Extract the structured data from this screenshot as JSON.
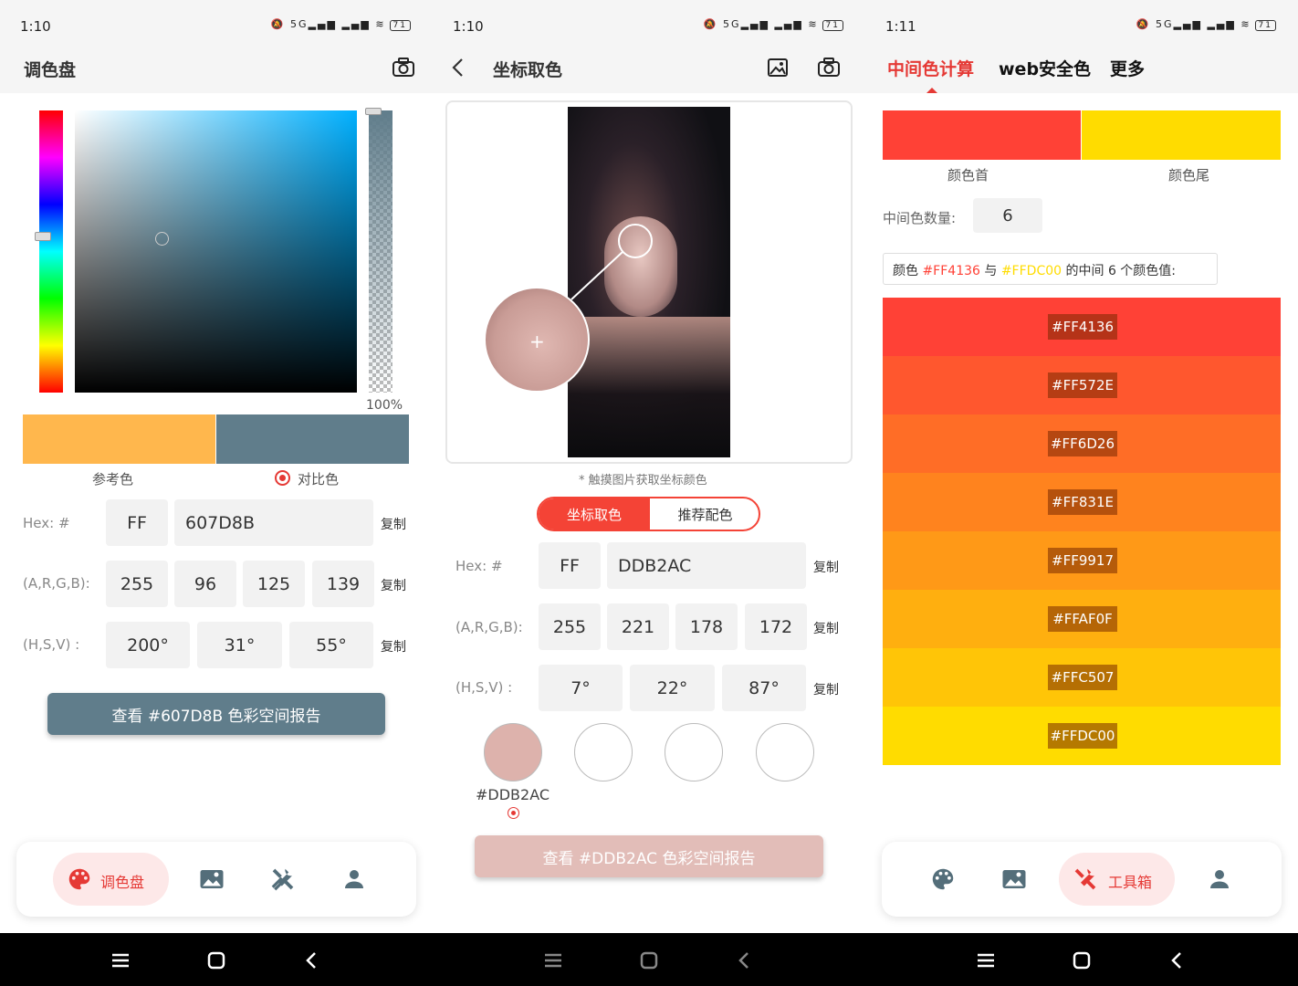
{
  "status": {
    "time_1": "1:10",
    "time_2": "1:10",
    "time_3": "1:11",
    "network": "5G",
    "battery": "71"
  },
  "palette_screen": {
    "title": "调色盘",
    "alpha_percent": "100%",
    "reference_label": "参考色",
    "contrast_label": "对比色",
    "reference_color": "#FFB74D",
    "contrast_color": "#607D8B",
    "hex_label": "Hex:  #",
    "alpha_hex": "FF",
    "hex_value": "607D8B",
    "argb_label": "(A,R,G,B):",
    "argb": [
      "255",
      "96",
      "125",
      "139"
    ],
    "hsv_label": "(H,S,V)  :",
    "hsv": [
      "200°",
      "31°",
      "55°"
    ],
    "copy_label": "复制",
    "report_button": "查看 #607D8B 色彩空间报告",
    "report_color": "#607D8B"
  },
  "picker_screen": {
    "title": "坐标取色",
    "hint": "* 触摸图片获取坐标颜色",
    "segment_left": "坐标取色",
    "segment_right": "推荐配色",
    "hex_label": "Hex:  #",
    "alpha_hex": "FF",
    "hex_value": "DDB2AC",
    "argb_label": "(A,R,G,B):",
    "argb": [
      "255",
      "221",
      "178",
      "172"
    ],
    "hsv_label": "(H,S,V)  :",
    "hsv": [
      "7°",
      "22°",
      "87°"
    ],
    "copy_label": "复制",
    "picked_color": "#DDB2AC",
    "picked_label": "#DDB2AC",
    "report_button": "查看 #DDB2AC 色彩空间报告"
  },
  "gradient_screen": {
    "tabs": [
      "中间色计算",
      "web安全色",
      "更多"
    ],
    "start_label": "颜色首",
    "end_label": "颜色尾",
    "start_color": "#FF4136",
    "end_color": "#FFDC00",
    "count_label": "中间色数量:",
    "count_value": "6",
    "summary_prefix": "颜色 ",
    "summary_start": "#FF4136",
    "summary_mid": " 与 ",
    "summary_end": "#FFDC00",
    "summary_suffix": " 的中间 6 个颜色值:",
    "colors": [
      "#FF4136",
      "#FF572E",
      "#FF6D26",
      "#FF831E",
      "#FF9917",
      "#FFAF0F",
      "#FFC507",
      "#FFDC00"
    ]
  },
  "bottom_tabs": {
    "palette": "调色盘",
    "toolbox": "工具箱"
  }
}
